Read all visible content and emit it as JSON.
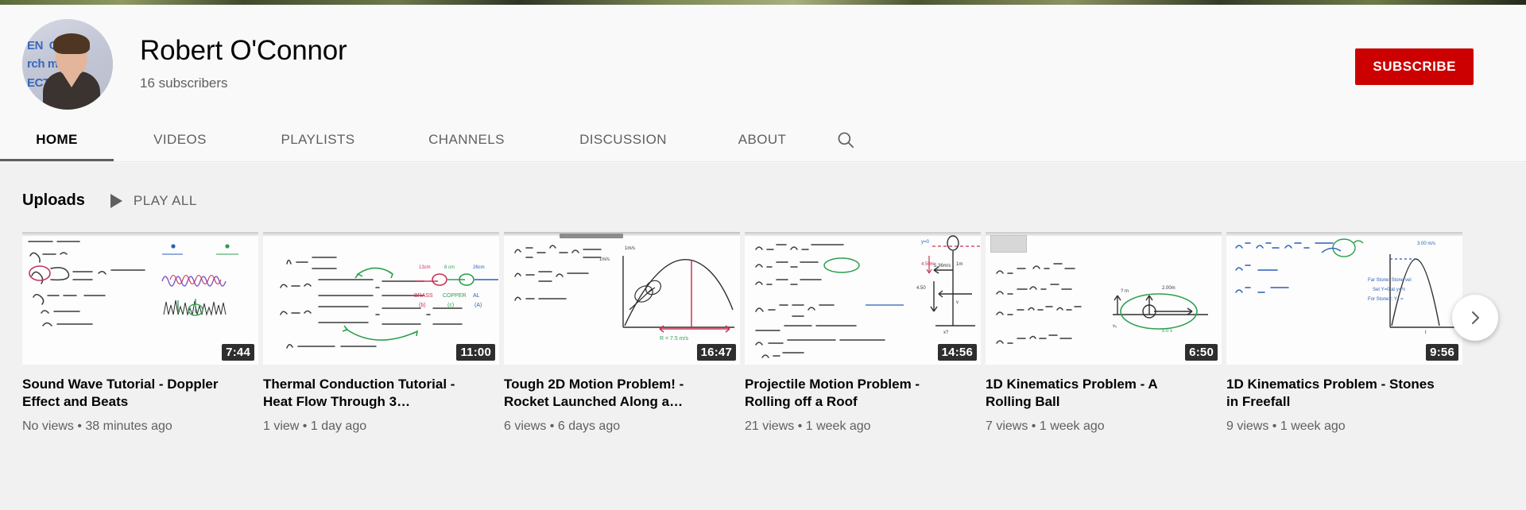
{
  "header": {
    "channel_name": "Robert O'Connor",
    "subscriber_count": "16 subscribers",
    "subscribe_label": "SUBSCRIBE",
    "subscribe_color": "#cc0000",
    "avatar_badge_text": "EN  OCU\nrch mov\nECT",
    "avatar_icon": "channel-avatar"
  },
  "tabs": [
    {
      "label": "HOME",
      "active": true,
      "name": "tab-home"
    },
    {
      "label": "VIDEOS",
      "active": false,
      "name": "tab-videos"
    },
    {
      "label": "PLAYLISTS",
      "active": false,
      "name": "tab-playlists"
    },
    {
      "label": "CHANNELS",
      "active": false,
      "name": "tab-channels"
    },
    {
      "label": "DISCUSSION",
      "active": false,
      "name": "tab-discussion"
    },
    {
      "label": "ABOUT",
      "active": false,
      "name": "tab-about"
    }
  ],
  "search": {
    "icon": "search-icon"
  },
  "shelf": {
    "title": "Uploads",
    "play_all_label": "PLAY ALL",
    "play_icon": "play-triangle-icon",
    "next_icon": "chevron-right-icon"
  },
  "videos": [
    {
      "title": "Sound Wave Tutorial - Doppler Effect and Beats",
      "duration": "7:44",
      "views": "No views",
      "age": "38 minutes ago",
      "meta": "No views • 38 minutes ago"
    },
    {
      "title": "Thermal Conduction Tutorial - Heat Flow Through 3…",
      "duration": "11:00",
      "views": "1 view",
      "age": "1 day ago",
      "meta": "1 view • 1 day ago"
    },
    {
      "title": "Tough 2D Motion Problem! - Rocket Launched Along a…",
      "duration": "16:47",
      "views": "6 views",
      "age": "6 days ago",
      "meta": "6 views • 6 days ago"
    },
    {
      "title": "Projectile Motion Problem - Rolling off a Roof",
      "duration": "14:56",
      "views": "21 views",
      "age": "1 week ago",
      "meta": "21 views • 1 week ago"
    },
    {
      "title": "1D Kinematics Problem - A Rolling Ball",
      "duration": "6:50",
      "views": "7 views",
      "age": "1 week ago",
      "meta": "7 views • 1 week ago"
    },
    {
      "title": "1D Kinematics Problem - Stones in Freefall",
      "duration": "9:56",
      "views": "9 views",
      "age": "1 week ago",
      "meta": "9 views • 1 week ago"
    }
  ]
}
